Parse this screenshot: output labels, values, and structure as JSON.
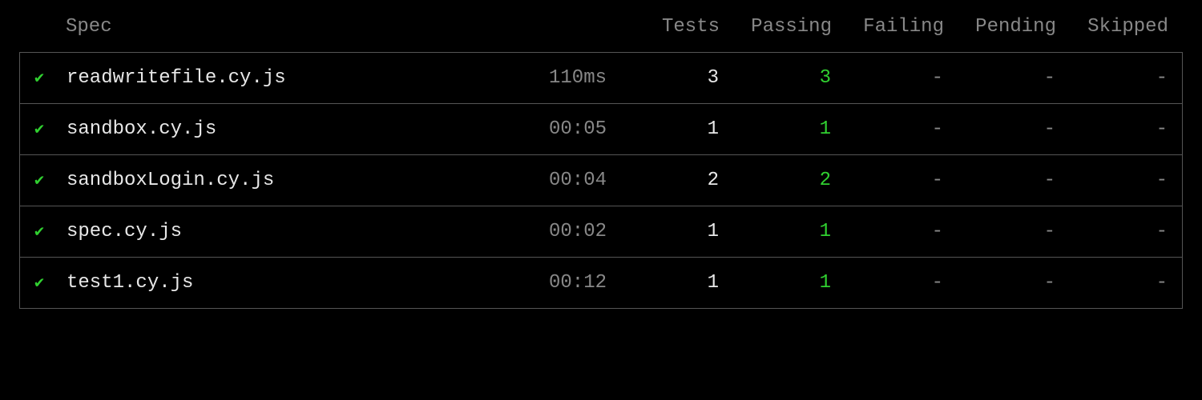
{
  "columns": {
    "spec": "Spec",
    "tests": "Tests",
    "passing": "Passing",
    "failing": "Failing",
    "pending": "Pending",
    "skipped": "Skipped"
  },
  "check_glyph": "✔",
  "dash": "-",
  "rows": [
    {
      "status": "pass",
      "spec": "readwritefile.cy.js",
      "time": "110ms",
      "tests": "3",
      "passing": "3",
      "failing": "-",
      "pending": "-",
      "skipped": "-"
    },
    {
      "status": "pass",
      "spec": "sandbox.cy.js",
      "time": "00:05",
      "tests": "1",
      "passing": "1",
      "failing": "-",
      "pending": "-",
      "skipped": "-"
    },
    {
      "status": "pass",
      "spec": "sandboxLogin.cy.js",
      "time": "00:04",
      "tests": "2",
      "passing": "2",
      "failing": "-",
      "pending": "-",
      "skipped": "-"
    },
    {
      "status": "pass",
      "spec": "spec.cy.js",
      "time": "00:02",
      "tests": "1",
      "passing": "1",
      "failing": "-",
      "pending": "-",
      "skipped": "-"
    },
    {
      "status": "pass",
      "spec": "test1.cy.js",
      "time": "00:12",
      "tests": "1",
      "passing": "1",
      "failing": "-",
      "pending": "-",
      "skipped": "-"
    }
  ]
}
